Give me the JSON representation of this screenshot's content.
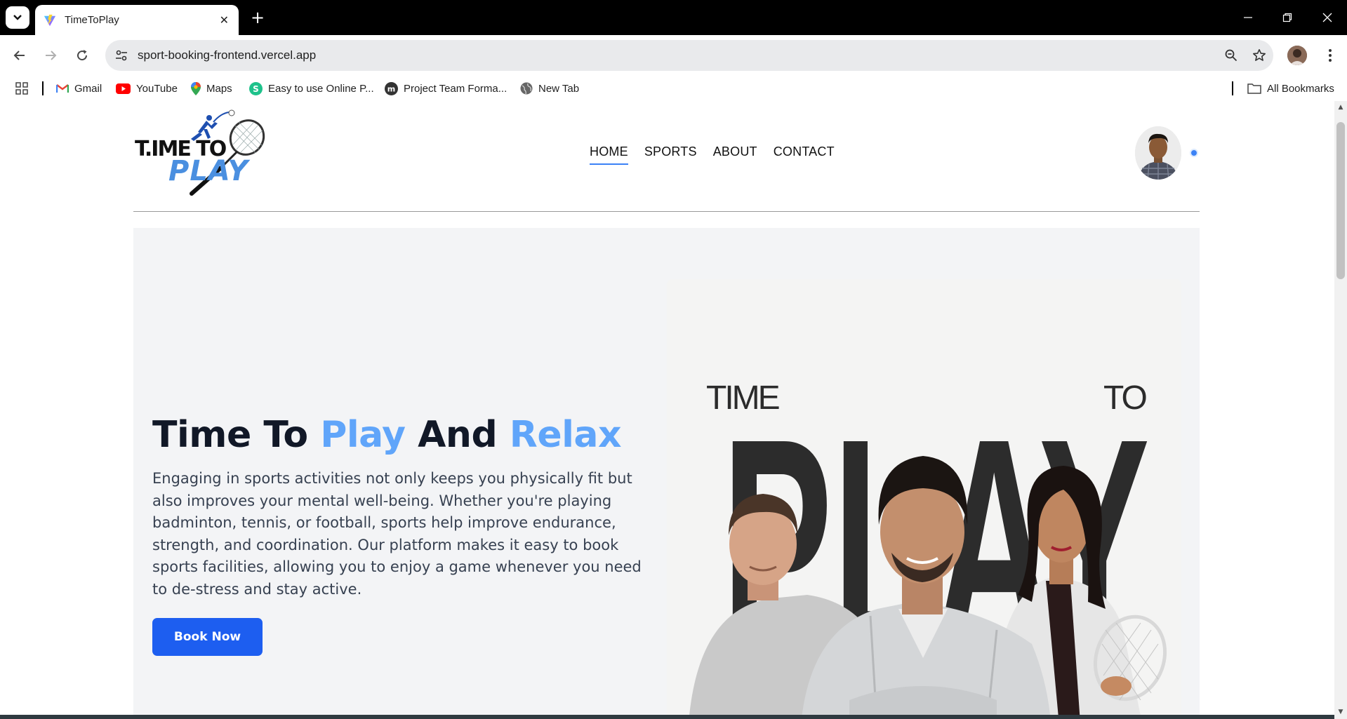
{
  "browser": {
    "tab_title": "TimeToPlay",
    "tab_close": "✕",
    "new_tab": "+",
    "url": "sport-booking-frontend.vercel.app",
    "bookmarks": [
      {
        "label": "Gmail",
        "icon": "gmail-icon"
      },
      {
        "label": "YouTube",
        "icon": "youtube-icon"
      },
      {
        "label": "Maps",
        "icon": "maps-icon"
      },
      {
        "label": "Easy to use Online P...",
        "icon": "s-icon"
      },
      {
        "label": "Project Team Forma...",
        "icon": "m-icon"
      },
      {
        "label": "New Tab",
        "icon": "globe-icon"
      }
    ],
    "all_bookmarks": "All Bookmarks"
  },
  "site": {
    "logo": {
      "line1": "T.IME TO",
      "line2": "PLAY"
    },
    "nav": [
      {
        "label": "HOME",
        "active": true
      },
      {
        "label": "SPORTS",
        "active": false
      },
      {
        "label": "ABOUT",
        "active": false
      },
      {
        "label": "CONTACT",
        "active": false
      }
    ],
    "colors": {
      "accent": "#60a5fa",
      "button": "#1d5ef0",
      "hero_bg": "#f3f4f6",
      "title": "#111827"
    }
  },
  "hero": {
    "title_parts": [
      "Time To ",
      "Play",
      " And ",
      "Relax"
    ],
    "description": "Engaging in sports activities not only keeps you physically fit but also improves your mental well-being. Whether you're playing badminton, tennis, or football, sports help improve endurance, strength, and coordination. Our platform makes it easy to book sports facilities, allowing you to enjoy a game whenever you need to de-stress and stay active.",
    "button": "Book Now"
  },
  "poster": {
    "word_time": "TIME",
    "word_to": "TO",
    "word_play": "PLAY"
  }
}
